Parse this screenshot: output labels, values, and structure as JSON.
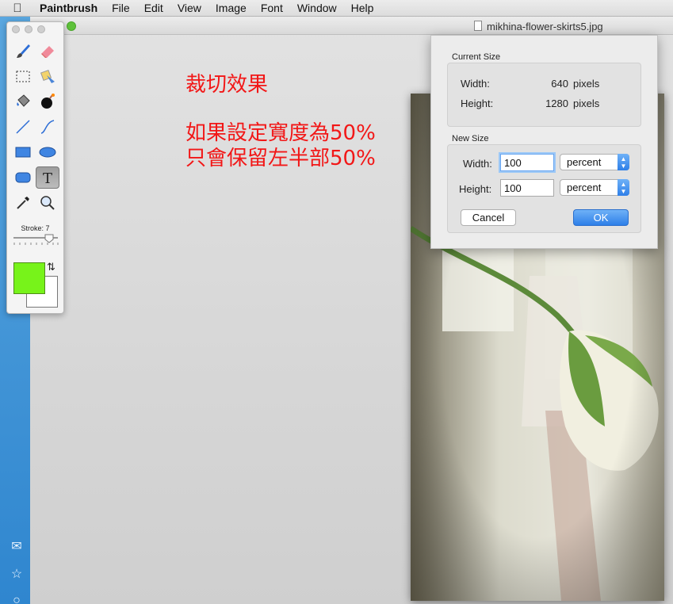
{
  "menubar": {
    "app_name": "Paintbrush",
    "items": [
      "File",
      "Edit",
      "View",
      "Image",
      "Font",
      "Window",
      "Help"
    ]
  },
  "window": {
    "title": "mikhina-flower-skirts5.jpg"
  },
  "annotation": {
    "heading": "裁切效果",
    "line1": "如果設定寬度為50%",
    "line2": "只會保留左半部50%"
  },
  "tools": {
    "names": [
      "paintbrush",
      "eraser",
      "rectangle-select",
      "text-select",
      "paint-bucket",
      "bomb",
      "line",
      "curve",
      "rectangle",
      "ellipse",
      "rounded-rectangle",
      "text",
      "eyedropper",
      "zoom"
    ],
    "selected": "text",
    "stroke_label": "Stroke: 7",
    "stroke_value": 7,
    "foreground_color": "#77f31a",
    "background_color": "#ffffff"
  },
  "dialog": {
    "current_size_label": "Current Size",
    "current_width_label": "Width:",
    "current_width_value": "640",
    "current_width_unit": "pixels",
    "current_height_label": "Height:",
    "current_height_value": "1280",
    "current_height_unit": "pixels",
    "new_size_label": "New Size",
    "new_width_label": "Width:",
    "new_width_value": "100",
    "new_width_unit": "percent",
    "new_height_label": "Height:",
    "new_height_value": "100",
    "new_height_unit": "percent",
    "cancel_label": "Cancel",
    "ok_label": "OK"
  },
  "colors": {
    "accent": "#2e7fe8",
    "annotation": "#f21717"
  }
}
